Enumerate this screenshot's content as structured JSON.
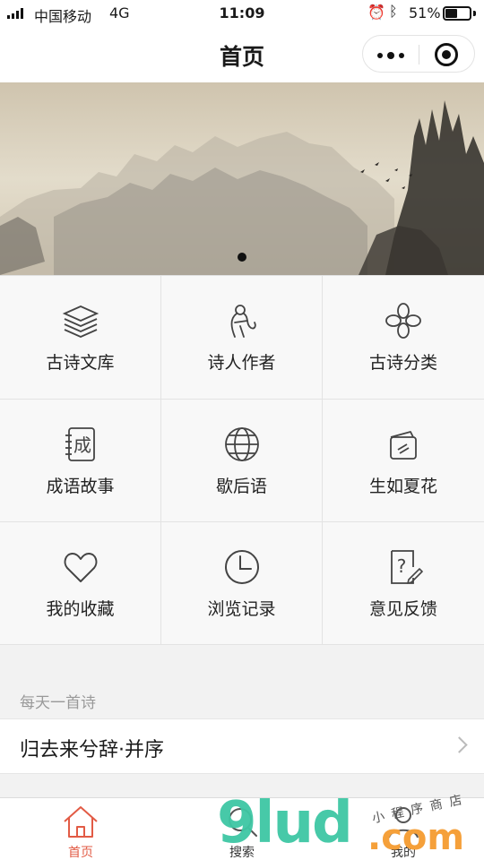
{
  "status_bar": {
    "carrier": "中国移动",
    "network": "4G",
    "time": "11:09",
    "battery_percent_text": "51%",
    "battery_level": 0.51,
    "alarm_icon": "alarm-clock-icon",
    "bluetooth_icon": "bluetooth-icon"
  },
  "nav": {
    "title": "首页",
    "more_icon": "more-dots-icon",
    "close_icon": "mini-program-close-icon"
  },
  "banner": {
    "image": "ink-wash-landscape",
    "slide_count": 1,
    "active_slide": 1
  },
  "menu": {
    "items": [
      {
        "label": "古诗文库",
        "icon": "stack-layers-icon"
      },
      {
        "label": "诗人作者",
        "icon": "poet-figure-icon"
      },
      {
        "label": "古诗分类",
        "icon": "clover-icon"
      },
      {
        "label": "成语故事",
        "icon": "notebook-cheng-icon",
        "icon_text": "成"
      },
      {
        "label": "歇后语",
        "icon": "globe-icon"
      },
      {
        "label": "生如夏花",
        "icon": "cards-icon"
      },
      {
        "label": "我的收藏",
        "icon": "heart-icon"
      },
      {
        "label": "浏览记录",
        "icon": "clock-icon"
      },
      {
        "label": "意见反馈",
        "icon": "feedback-question-icon"
      }
    ]
  },
  "daily": {
    "section_label": "每天一首诗",
    "poem_title": "归去来兮辞·并序"
  },
  "tabs": [
    {
      "label": "首页",
      "icon": "home-icon",
      "active": true
    },
    {
      "label": "搜索",
      "icon": "search-icon",
      "active": false
    },
    {
      "label": "我的",
      "icon": "profile-icon",
      "active": false
    }
  ],
  "watermark": {
    "brand": "9lud",
    "suffix": ".com",
    "tagline": "小程序商店"
  },
  "colors": {
    "accent": "#e25b45",
    "watermark_green": "#3ec7a4",
    "watermark_orange": "#f5a03a"
  }
}
